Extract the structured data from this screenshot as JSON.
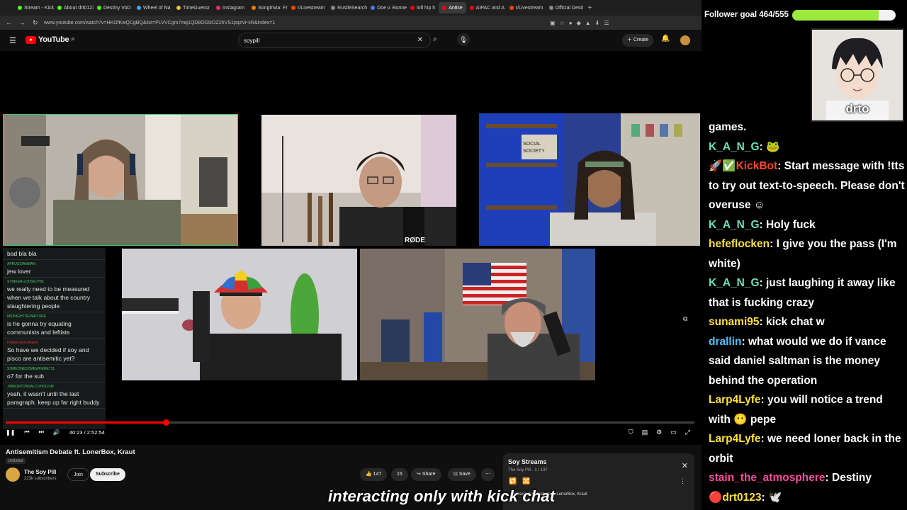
{
  "browser": {
    "tabs": [
      {
        "label": "Stream - Kick",
        "color": "#53fc18"
      },
      {
        "label": "About drt0123",
        "color": "#53fc18"
      },
      {
        "label": "Destiny VoD",
        "color": "#53fc18"
      },
      {
        "label": "Wheel of Na",
        "color": "#3ea6ff"
      },
      {
        "label": "TimeGuessr",
        "color": "#f0c040"
      },
      {
        "label": "Instagram",
        "color": "#e1306c"
      },
      {
        "label": "Songtrivia: Fr",
        "color": "#ff7a00"
      },
      {
        "label": "r/Livestream",
        "color": "#ff4500"
      },
      {
        "label": "RustleSearch",
        "color": "#888888"
      },
      {
        "label": "Doe v. Bonne",
        "color": "#4b7bec"
      },
      {
        "label": "lofi hip h",
        "color": "#ff0000"
      },
      {
        "label": "Antise",
        "color": "#ff0000",
        "active": true
      },
      {
        "label": "AIPAC and A",
        "color": "#ff0000"
      },
      {
        "label": "r/Livestream",
        "color": "#ff4500"
      },
      {
        "label": "Official Desti",
        "color": "#888888"
      }
    ],
    "new_tab": "+",
    "url": "www.youtube.com/watch?v=HKOfKwQCgBQ&list=PLVVCgm7mq1QD8OGlzOZ2lrVS1pqzVr-xR&index=1"
  },
  "youtube": {
    "logo_text": "YouTube",
    "logo_sup": "86",
    "search_value": "soypill",
    "create_label": "Create"
  },
  "overlay_chat": [
    {
      "user": "",
      "text": "bad bla bla"
    },
    {
      "user": "APRUSSIANMAN",
      "text": "jew lover"
    },
    {
      "user": "STINKER-LOOSE7785",
      "text": "we really need to be measured when we talk about the country slaughtering people"
    },
    {
      "user": "MIDNIGHTDEPARTURE",
      "text": "is he gonna try equating communists and leftists"
    },
    {
      "user": "KWEEFSOURGEN",
      "text": "So have we decided if soy and pisco are antisemitic yet?",
      "red": true
    },
    {
      "user": "SOMEONESOMEWHERE711",
      "text": "o7 for the sub"
    },
    {
      "user": "JIMNORTONSALCOHOLISM",
      "text": "yeah, it wasn't until the last paragraph. keep up far right buddy"
    }
  ],
  "player": {
    "time": "40:23 / 2:52:54",
    "progress": 0.233
  },
  "video": {
    "title": "Antisemitism Debate ft. LonerBox, Kraut",
    "unlisted": "Unlisted",
    "channel": "The Soy Pill",
    "subscribers": "223k subscribers",
    "join": "Join",
    "subscribe": "Subscribe",
    "likes": "147",
    "dislikes": "15",
    "share": "Share",
    "save": "Save"
  },
  "playlist": {
    "title": "Soy Streams",
    "sub": "The Soy Pill - 1 / 137",
    "item": "Antisemitism Debate ft. LonerBox, Kraut"
  },
  "caption": "interacting only with kick chat",
  "stream_overlay": {
    "goal_label": "Follower goal 464/555",
    "goal_current": 464,
    "goal_target": 555,
    "cam_label": "drto"
  },
  "kick_chat": [
    {
      "user": "",
      "text": "games.",
      "color": "#ffffff"
    },
    {
      "user": "K_A_N_G",
      "text": "🐸",
      "color": "#6ee0b9"
    },
    {
      "user": "KickBot",
      "text": "Start message with !tts to try out text-to-speech. Please don't overuse ☺",
      "color": "#ff4a2a",
      "badges": "🚀✅"
    },
    {
      "user": "K_A_N_G",
      "text": "Holy fuck",
      "color": "#6ee0b9"
    },
    {
      "user": "hefeflocken",
      "text": "I give you the pass (I'm white)",
      "color": "#ffe135"
    },
    {
      "user": "K_A_N_G",
      "text": "just laughing it away like that is fucking crazy",
      "color": "#6ee0b9"
    },
    {
      "user": "sunami95",
      "text": "kick chat w",
      "color": "#ffe135"
    },
    {
      "user": "drallin",
      "text": "what would we do if vance said daniel saltman is the money behind the operation",
      "color": "#4fc3ff"
    },
    {
      "user": "Larp4Lyfe",
      "text": "you will notice a trend with 😶 pepe",
      "color": "#ffe135"
    },
    {
      "user": "Larp4Lyfe",
      "text": "we need loner back in the orbit",
      "color": "#ffe135"
    },
    {
      "user": "stain_the_atmosphere",
      "text": "Destiny",
      "color": "#ff4d9d"
    },
    {
      "user": "drt0123",
      "text": "🕊️",
      "color": "#ffe135",
      "badges": "🔴"
    }
  ]
}
